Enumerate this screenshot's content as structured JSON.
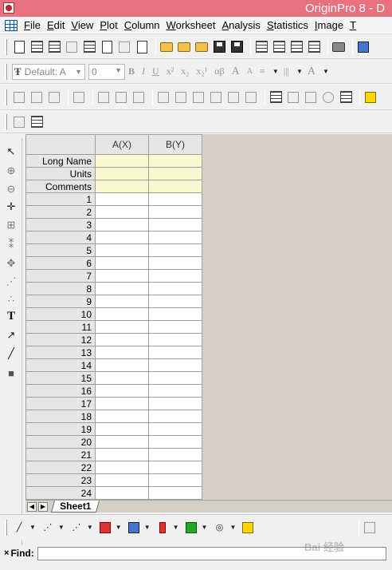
{
  "titlebar": {
    "title": "OriginPro 8 - D"
  },
  "menubar": {
    "items": [
      {
        "accel": "F",
        "rest": "ile"
      },
      {
        "accel": "E",
        "rest": "dit"
      },
      {
        "accel": "V",
        "rest": "iew"
      },
      {
        "accel": "P",
        "rest": "lot"
      },
      {
        "accel": "C",
        "rest": "olumn"
      },
      {
        "accel": "W",
        "rest": "orksheet"
      },
      {
        "accel": "A",
        "rest": "nalysis"
      },
      {
        "accel": "S",
        "rest": "tatistics"
      },
      {
        "accel": "I",
        "rest": "mage"
      },
      {
        "accel": "T",
        "rest": ""
      }
    ]
  },
  "format_toolbar": {
    "font": "Default: A",
    "size": "0",
    "bold": "B",
    "italic": "I",
    "underline": "U",
    "superscript": "x²",
    "subscript": "x₂",
    "supersub": "x₂¹",
    "greek": "αβ",
    "grow_font": "A",
    "shrink_font": "A"
  },
  "worksheet": {
    "columns": [
      "A(X)",
      "B(Y)"
    ],
    "meta_rows": [
      "Long Name",
      "Units",
      "Comments"
    ],
    "rows": [
      "1",
      "2",
      "3",
      "4",
      "5",
      "6",
      "7",
      "8",
      "9",
      "10",
      "11",
      "12",
      "13",
      "14",
      "15",
      "16",
      "17",
      "18",
      "19",
      "20",
      "21",
      "22",
      "23",
      "24"
    ]
  },
  "sheet_tab": "Sheet1",
  "findbar": {
    "label": "Find:",
    "close": "×",
    "value": ""
  },
  "watermark": "Bai 经验"
}
